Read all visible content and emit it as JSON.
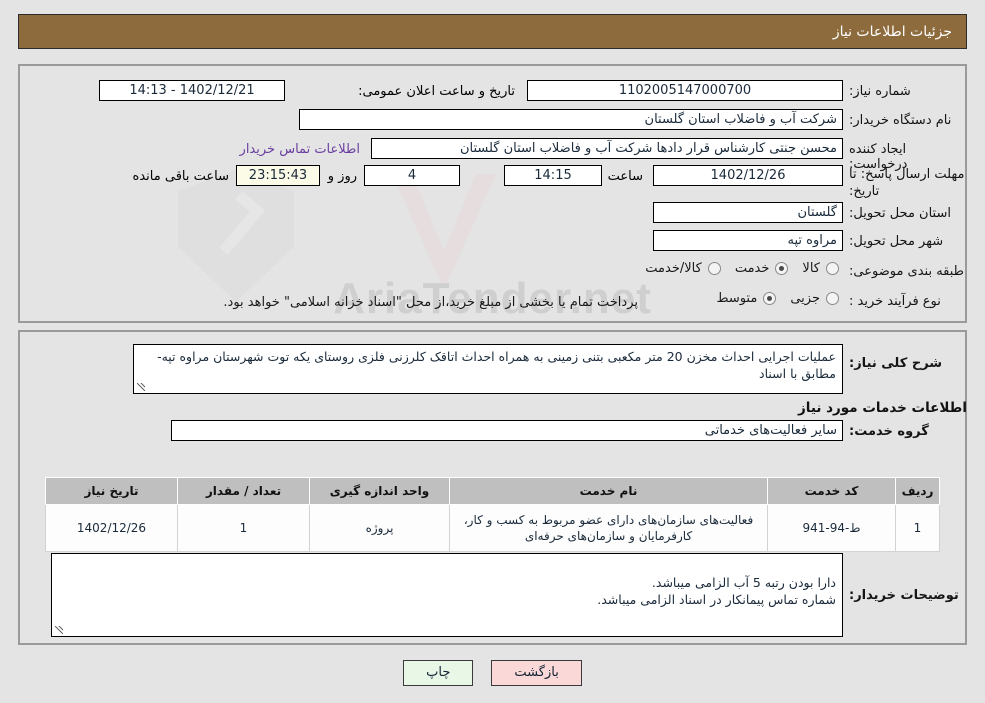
{
  "header": {
    "title": "جزئیات اطلاعات نیاز"
  },
  "colors": {
    "header_bg": "#8d6b3d",
    "page_bg": "#e4e4e4",
    "link": "#6a3fa0",
    "timer_bg": "#fbfbe8",
    "table_header_bg": "#bfbfbf",
    "print_btn_bg": "#e9f7e7",
    "back_btn_bg": "#fbd8d8"
  },
  "top_form": {
    "need_number_label": "شماره نیاز:",
    "need_number_value": "1102005147000700",
    "announce_label": "تاریخ و ساعت اعلان عمومی:",
    "announce_value": "1402/12/21 - 14:13",
    "buyer_org_label": "نام دستگاه خریدار:",
    "buyer_org_value": "شرکت آب و فاضلاب استان گلستان",
    "creator_label": "ایجاد کننده درخواست:",
    "creator_value": "محسن جنتی کارشناس قرار دادها شرکت آب و فاضلاب استان گلستان",
    "contact_link": "اطلاعات تماس خریدار",
    "deadline_label": "مهلت ارسال پاسخ: تا تاریخ:",
    "deadline_date": "1402/12/26",
    "hour_label": "ساعت",
    "deadline_time": "14:15",
    "days_value": "4",
    "days_label": "روز و",
    "countdown_value": "23:15:43",
    "remaining_label": "ساعت باقی مانده",
    "province_label": "استان محل تحویل:",
    "province_value": "گلستان",
    "city_label": "شهر محل تحویل:",
    "city_value": "مراوه تپه",
    "category_label": "طبقه بندی موضوعی:",
    "category_options": [
      {
        "label": "کالا",
        "selected": false
      },
      {
        "label": "خدمت",
        "selected": true
      },
      {
        "label": "کالا/خدمت",
        "selected": false
      }
    ],
    "process_label": "نوع فرآیند خرید :",
    "process_options": [
      {
        "label": "جزیی",
        "selected": false
      },
      {
        "label": "متوسط",
        "selected": true
      }
    ],
    "payment_note": "پرداخت تمام یا بخشی از مبلغ خرید،از محل \"اسناد خزانه اسلامی\" خواهد بود."
  },
  "description": {
    "label": "شرح کلی نیاز:",
    "value": "عملیات اجرایی احداث مخزن 20 متر مکعبی بتنی زمینی به همراه احداث اتاقک کلرزنی فلزی روستای یکه توت شهرستان مراوه تپه-مطابق با اسناد"
  },
  "services_section": {
    "heading": "اطلاعات خدمات مورد نیاز",
    "group_label": "گروه خدمت:",
    "group_value": "سایر فعالیت‌های خدماتی",
    "table": {
      "columns": [
        "ردیف",
        "کد خدمت",
        "نام خدمت",
        "واحد اندازه گیری",
        "تعداد / مقدار",
        "تاریخ نیاز"
      ],
      "rows": [
        {
          "row_no": "1",
          "service_code": "ط-94-941",
          "service_name": "فعالیت‌های سازمان‌های دارای عضو مربوط به کسب و کار، کارفرمایان و سازمان‌های حرفه‌ای",
          "unit": "پروژه",
          "quantity": "1",
          "need_date": "1402/12/26"
        }
      ]
    }
  },
  "buyer_notes": {
    "label": "توضیحات خریدار:",
    "value": "دارا بودن رتبه 5 آب الزامی میباشد.\nشماره تماس پیمانکار در اسناد الزامی میباشد."
  },
  "footer": {
    "print_label": "چاپ",
    "back_label": "بازگشت"
  },
  "watermark": {
    "text": "AriaTender.net"
  }
}
